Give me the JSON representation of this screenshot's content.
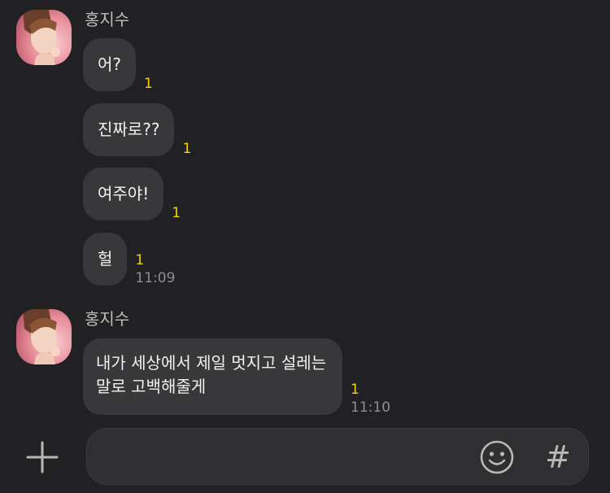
{
  "conversation": [
    {
      "sender": "홍지수",
      "avatar": "profile-photo",
      "messages": [
        {
          "text": "어?",
          "unread": "1",
          "time": ""
        },
        {
          "text": "진짜로??",
          "unread": "1",
          "time": ""
        },
        {
          "text": "여주야!",
          "unread": "1",
          "time": ""
        },
        {
          "text": "헐",
          "unread": "1",
          "time": "11:09"
        }
      ]
    },
    {
      "sender": "홍지수",
      "avatar": "profile-photo",
      "messages": [
        {
          "text": "내가 세상에서 제일 멋지고 설레는\n말로 고백해줄게",
          "unread": "1",
          "time": "11:10"
        }
      ]
    }
  ],
  "input": {
    "value": "",
    "placeholder": ""
  },
  "icons": {
    "add": "plus-icon",
    "emoticon": "emoticon-icon",
    "hashtag": "#"
  },
  "colors": {
    "background": "#212123",
    "bubble": "#38383a",
    "unread": "#f2d600",
    "time": "#8e8e90"
  }
}
